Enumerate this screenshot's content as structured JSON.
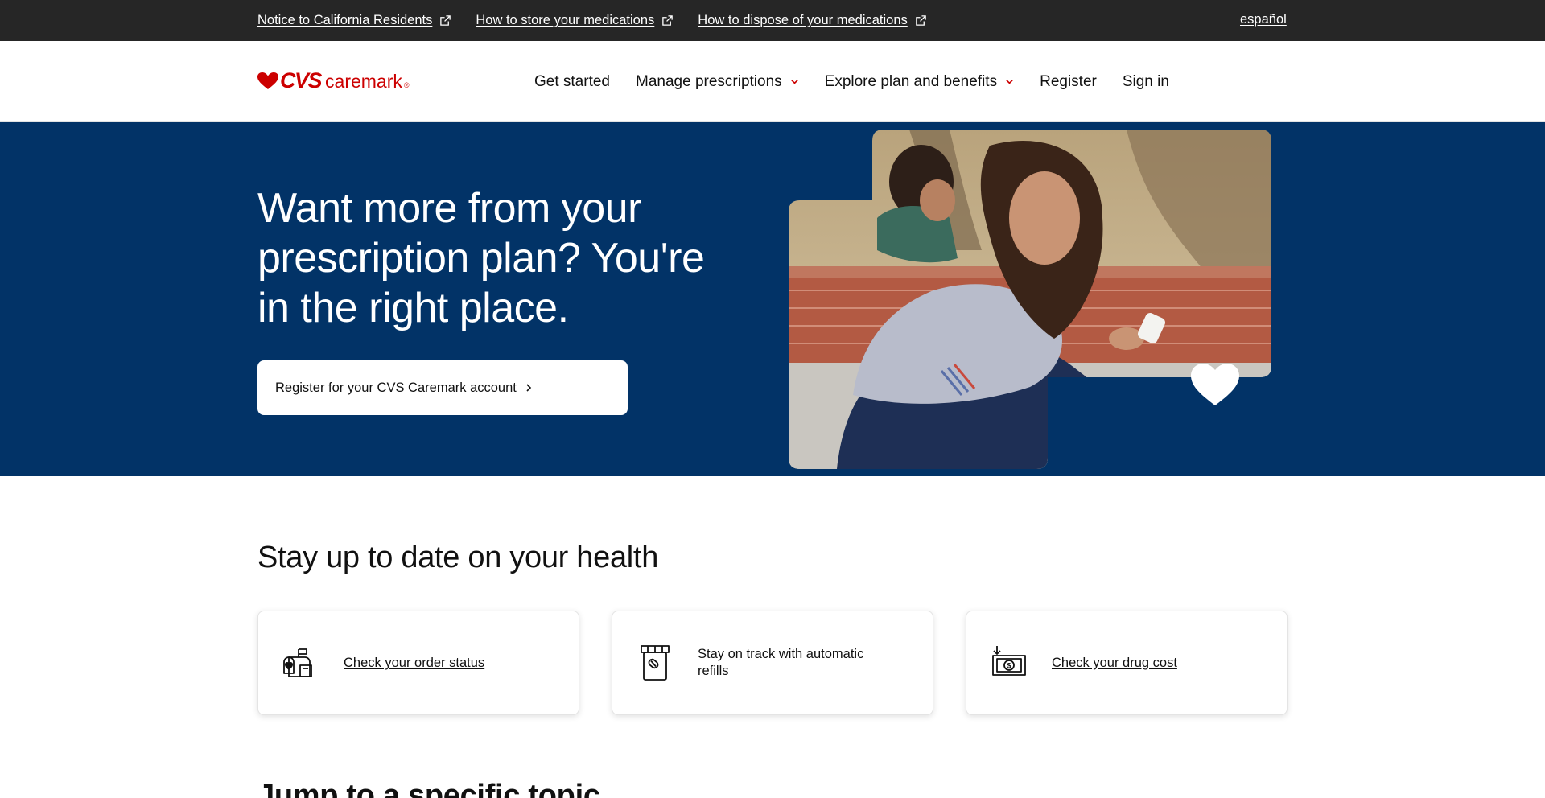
{
  "utility_bar": {
    "links": [
      {
        "label": "Notice to California Residents",
        "icon": "external-link-icon"
      },
      {
        "label": "How to store your medications",
        "icon": "external-link-icon"
      },
      {
        "label": "How to dispose of your medications",
        "icon": "external-link-icon"
      }
    ],
    "language": "español"
  },
  "header": {
    "logo": {
      "brand": "CVS",
      "product": "caremark",
      "mark": "®",
      "icon": "heart-logo-icon"
    },
    "nav": [
      {
        "label": "Get started"
      },
      {
        "label": "Manage prescriptions",
        "icon": "chevron-down-icon"
      },
      {
        "label": "Explore plan and benefits",
        "icon": "chevron-down-icon"
      },
      {
        "label": "Register"
      },
      {
        "label": "Sign in"
      }
    ]
  },
  "hero": {
    "title": "Want more from your prescription plan? You're in the right place.",
    "cta_label": "Register for your CVS Caremark account",
    "photo_icon": "heart-icon"
  },
  "health_section": {
    "title": "Stay up to date on your health",
    "cards": [
      {
        "label": "Check your order status",
        "icon": "mailbox-icon"
      },
      {
        "label": "Stay on track with automatic refills",
        "icon": "pill-bottle-icon"
      },
      {
        "label": "Check your drug cost",
        "icon": "dollar-bill-icon"
      }
    ]
  },
  "topic_section": {
    "title": "Jump to a specific topic"
  },
  "colors": {
    "brand_red": "#cc0000",
    "hero_blue": "#023367",
    "utility_bg": "#262626"
  }
}
